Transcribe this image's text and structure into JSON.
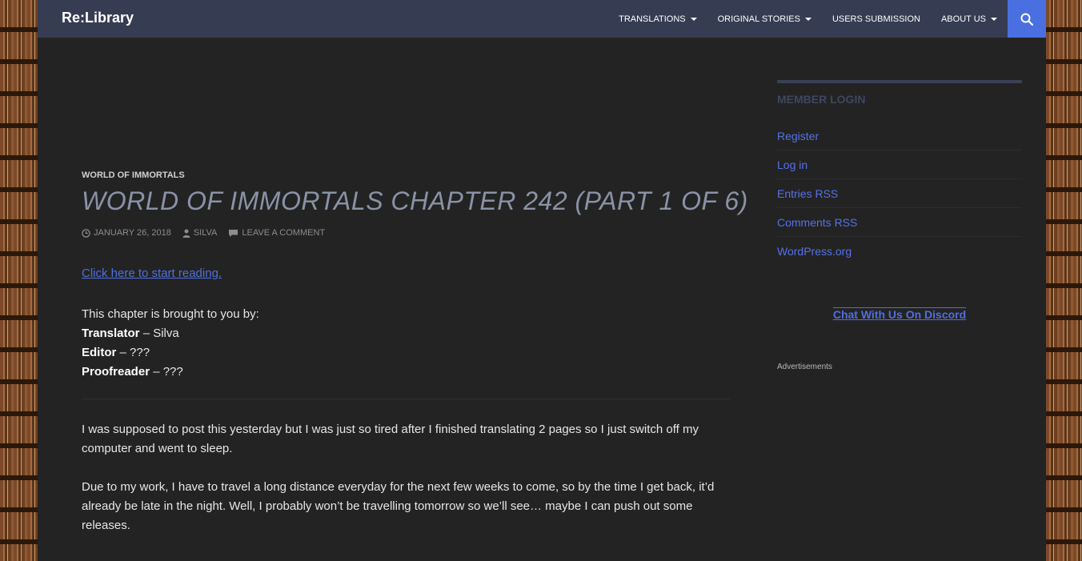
{
  "site": {
    "title": "Re:Library"
  },
  "nav": {
    "items": [
      {
        "label": "TRANSLATIONS",
        "dropdown": true
      },
      {
        "label": "ORIGINAL STORIES",
        "dropdown": true
      },
      {
        "label": "USERS SUBMISSION",
        "dropdown": false
      },
      {
        "label": "ABOUT US",
        "dropdown": true
      }
    ],
    "search_icon": "search-icon",
    "search_bg": "#4a6fe0"
  },
  "post": {
    "category": "WORLD OF IMMORTALS",
    "title": "WORLD OF IMMORTALS CHAPTER 242 (PART 1 OF 6)",
    "date": "JANUARY 26, 2018",
    "author": "SILVA",
    "comment_link": "LEAVE A COMMENT",
    "start_link": "Click here to start reading.",
    "credits": {
      "intro": "This chapter is brought to you by:",
      "translator_label": "Translator",
      "translator_value": " – Silva",
      "editor_label": "Editor",
      "editor_value": " – ???",
      "proofreader_label": "Proofreader",
      "proofreader_value": " – ???"
    },
    "paragraph1": "I was supposed to post this yesterday but I was just so tired after I finished translating 2 pages so I just switch off my computer and went to sleep.",
    "paragraph2": "Due to my work, I have to travel a long distance everyday for the next few weeks to come, so by the time I get back, it’d already be late in the night. Well, I probably won’t be travelling tomorrow so we’ll see… maybe I can push out some releases."
  },
  "sidebar": {
    "widget_title": "MEMBER LOGIN",
    "login_links": [
      "Register",
      "Log in",
      "Entries RSS",
      "Comments RSS",
      "WordPress.org"
    ],
    "discord_link": "Chat With Us On Discord",
    "ads_label": "Advertisements"
  },
  "colors": {
    "header_bg": "#363c52",
    "page_bg": "#232323",
    "link": "#4f6fe0",
    "title": "#8a92a6"
  }
}
